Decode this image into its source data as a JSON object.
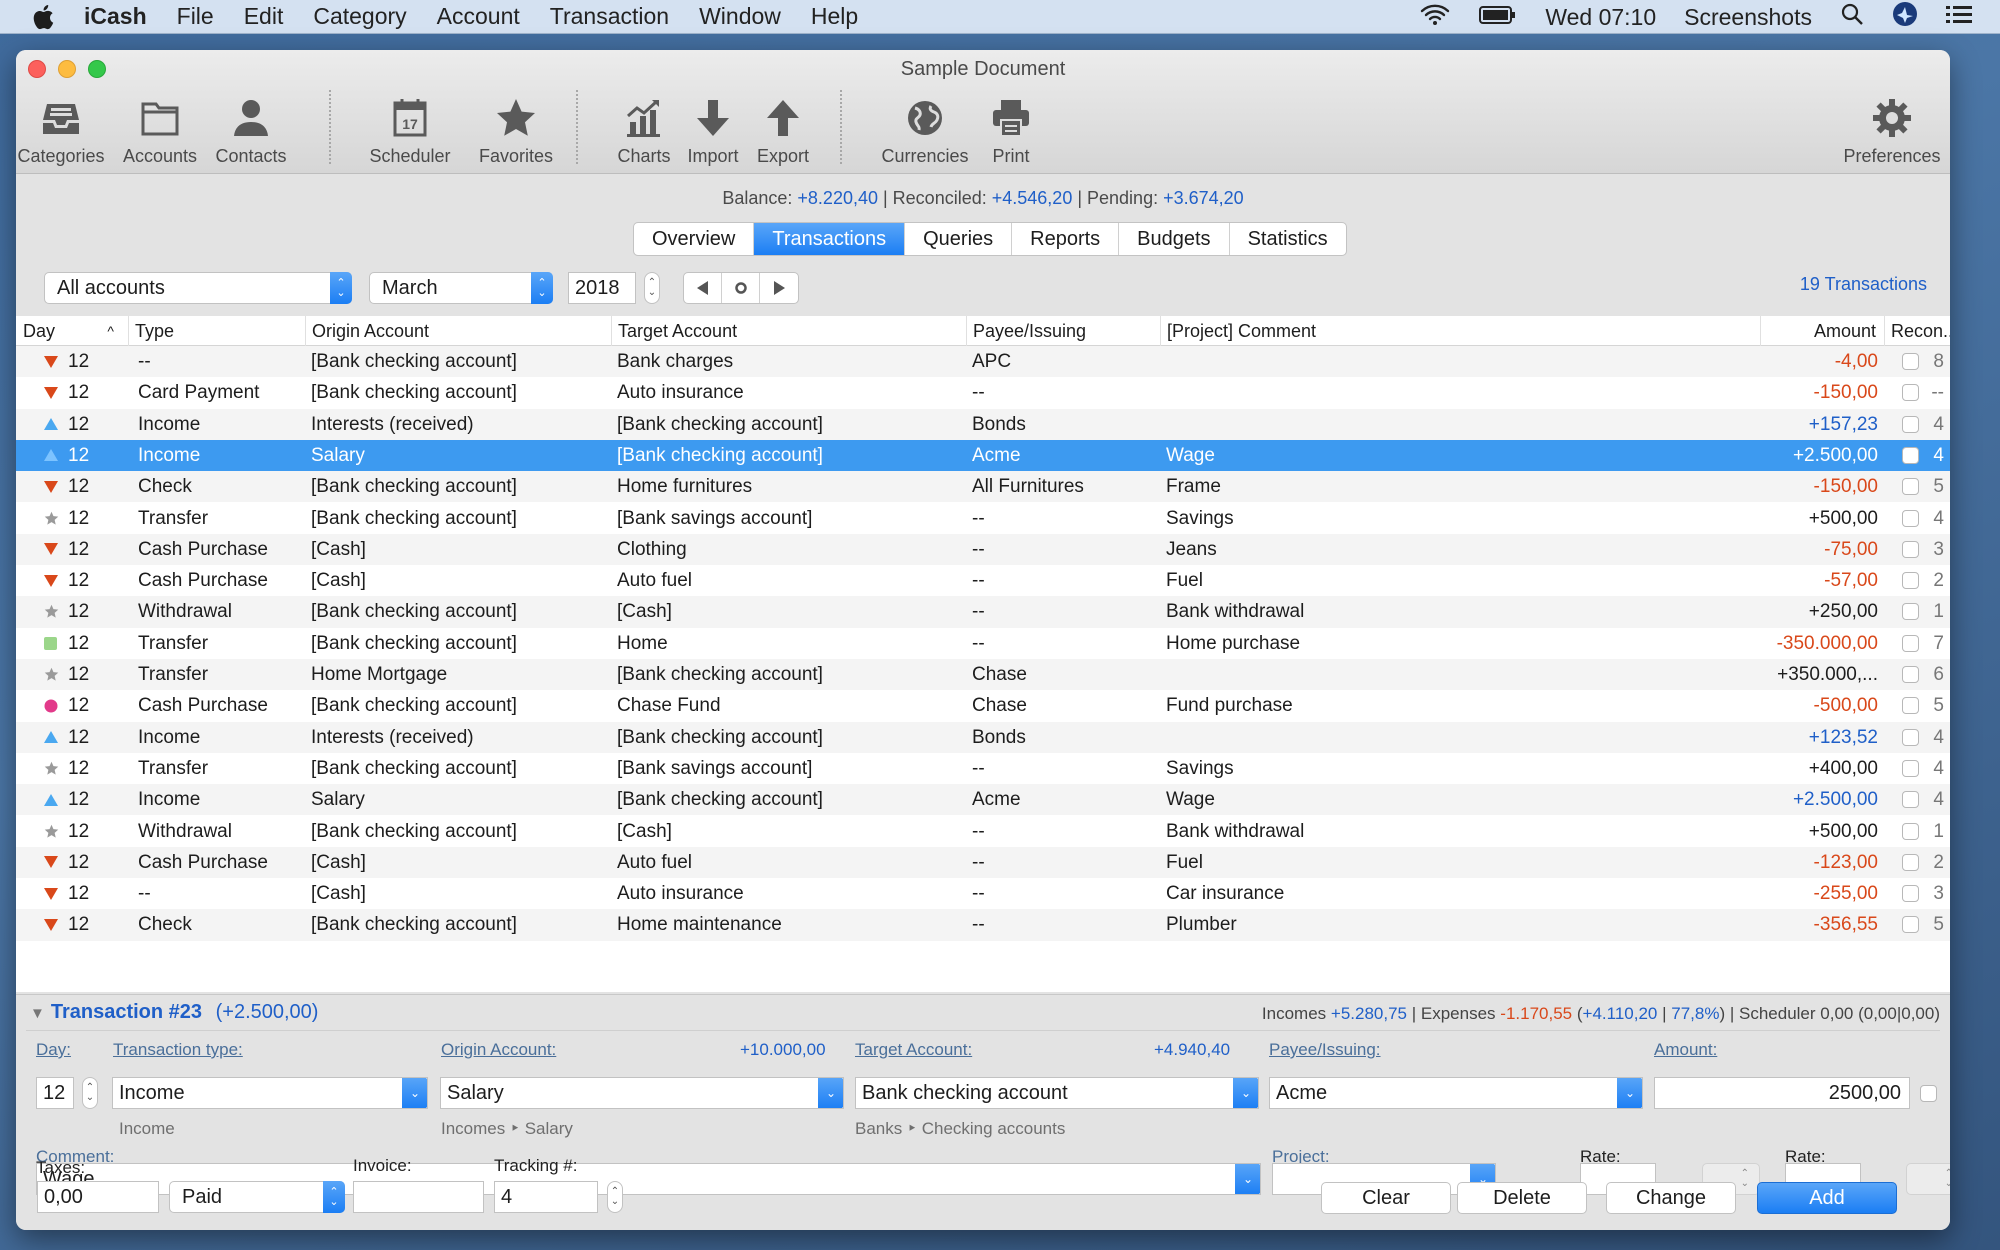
{
  "menubar": {
    "app_name": "iCash",
    "items": [
      "File",
      "Edit",
      "Category",
      "Account",
      "Transaction",
      "Window",
      "Help"
    ],
    "clock": "Wed 07:10",
    "user": "Screenshots"
  },
  "window": {
    "title": "Sample Document"
  },
  "toolbar": {
    "categories": "Categories",
    "accounts": "Accounts",
    "contacts": "Contacts",
    "scheduler": "Scheduler",
    "scheduler_day": "17",
    "favorites": "Favorites",
    "charts": "Charts",
    "import": "Import",
    "export": "Export",
    "currencies": "Currencies",
    "print": "Print",
    "preferences": "Preferences"
  },
  "balance": {
    "balance_label": "Balance:",
    "balance_value": "+8.220,40",
    "reconciled_label": "Reconciled:",
    "reconciled_value": "+4.546,20",
    "pending_label": "Pending:",
    "pending_value": "+3.674,20",
    "sep": " | "
  },
  "tabs": [
    {
      "label": "Overview",
      "active": false
    },
    {
      "label": "Transactions",
      "active": true
    },
    {
      "label": "Queries",
      "active": false
    },
    {
      "label": "Reports",
      "active": false
    },
    {
      "label": "Budgets",
      "active": false
    },
    {
      "label": "Statistics",
      "active": false
    }
  ],
  "filters": {
    "account": "All accounts",
    "month": "March",
    "year": "2018",
    "count": "19 Transactions"
  },
  "table": {
    "columns": [
      "Day",
      "Type",
      "Origin Account",
      "Target Account",
      "Payee/Issuing",
      "[Project] Comment",
      "Amount",
      "Recon..."
    ],
    "colors": {
      "expense": "#d9481a",
      "income": "#1f5fc8",
      "neutral": "#1d1d1d"
    },
    "rows": [
      {
        "icon": "down-triangle",
        "day": "12",
        "type": "--",
        "origin": "[Bank checking account]",
        "target": "Bank charges",
        "payee": "APC",
        "comment": "",
        "amount": "-4,00",
        "kind": "expense",
        "reconciled": false,
        "num": "8"
      },
      {
        "icon": "down-triangle",
        "day": "12",
        "type": "Card Payment",
        "origin": "[Bank checking account]",
        "target": "Auto insurance",
        "payee": "--",
        "comment": "",
        "amount": "-150,00",
        "kind": "expense",
        "reconciled": false,
        "num": "--"
      },
      {
        "icon": "up-triangle",
        "day": "12",
        "type": "Income",
        "origin": "Interests (received)",
        "target": "[Bank checking account]",
        "payee": "Bonds",
        "comment": "",
        "amount": "+157,23",
        "kind": "income",
        "reconciled": false,
        "num": "4"
      },
      {
        "icon": "up-triangle",
        "day": "12",
        "type": "Income",
        "origin": "Salary",
        "target": "[Bank checking account]",
        "payee": "Acme",
        "comment": "Wage",
        "amount": "+2.500,00",
        "kind": "income",
        "reconciled": false,
        "num": "4",
        "selected": true
      },
      {
        "icon": "down-triangle",
        "day": "12",
        "type": "Check",
        "origin": "[Bank checking account]",
        "target": "Home furnitures",
        "payee": "All Furnitures",
        "comment": "Frame",
        "amount": "-150,00",
        "kind": "expense",
        "reconciled": false,
        "num": "5"
      },
      {
        "icon": "star",
        "day": "12",
        "type": "Transfer",
        "origin": "[Bank checking account]",
        "target": "[Bank savings account]",
        "payee": "--",
        "comment": "Savings",
        "amount": "+500,00",
        "kind": "neutral",
        "reconciled": false,
        "num": "4"
      },
      {
        "icon": "down-triangle",
        "day": "12",
        "type": "Cash Purchase",
        "origin": "[Cash]",
        "target": "Clothing",
        "payee": "--",
        "comment": "Jeans",
        "amount": "-75,00",
        "kind": "expense",
        "reconciled": false,
        "num": "3"
      },
      {
        "icon": "down-triangle",
        "day": "12",
        "type": "Cash Purchase",
        "origin": "[Cash]",
        "target": "Auto fuel",
        "payee": "--",
        "comment": "Fuel",
        "amount": "-57,00",
        "kind": "expense",
        "reconciled": false,
        "num": "2"
      },
      {
        "icon": "star",
        "day": "12",
        "type": "Withdrawal",
        "origin": "[Bank checking account]",
        "target": "[Cash]",
        "payee": "--",
        "comment": "Bank withdrawal",
        "amount": "+250,00",
        "kind": "neutral",
        "reconciled": false,
        "num": "1"
      },
      {
        "icon": "square",
        "day": "12",
        "type": "Transfer",
        "origin": "[Bank checking account]",
        "target": "Home",
        "payee": "--",
        "comment": "Home purchase",
        "amount": "-350.000,00",
        "kind": "expense",
        "reconciled": false,
        "num": "7"
      },
      {
        "icon": "star",
        "day": "12",
        "type": "Transfer",
        "origin": "Home Mortgage",
        "target": "[Bank checking account]",
        "payee": "Chase",
        "comment": "",
        "amount": "+350.000,...",
        "kind": "neutral",
        "reconciled": false,
        "num": "6"
      },
      {
        "icon": "circle",
        "day": "12",
        "type": "Cash Purchase",
        "origin": "[Bank checking account]",
        "target": "Chase Fund",
        "payee": "Chase",
        "comment": "Fund purchase",
        "amount": "-500,00",
        "kind": "expense",
        "reconciled": false,
        "num": "5"
      },
      {
        "icon": "up-triangle",
        "day": "12",
        "type": "Income",
        "origin": "Interests (received)",
        "target": "[Bank checking account]",
        "payee": "Bonds",
        "comment": "",
        "amount": "+123,52",
        "kind": "income",
        "reconciled": false,
        "num": "4"
      },
      {
        "icon": "star",
        "day": "12",
        "type": "Transfer",
        "origin": "[Bank checking account]",
        "target": "[Bank savings account]",
        "payee": "--",
        "comment": "Savings",
        "amount": "+400,00",
        "kind": "neutral",
        "reconciled": false,
        "num": "4"
      },
      {
        "icon": "up-triangle",
        "day": "12",
        "type": "Income",
        "origin": "Salary",
        "target": "[Bank checking account]",
        "payee": "Acme",
        "comment": "Wage",
        "amount": "+2.500,00",
        "kind": "income",
        "reconciled": false,
        "num": "4"
      },
      {
        "icon": "star",
        "day": "12",
        "type": "Withdrawal",
        "origin": "[Bank checking account]",
        "target": "[Cash]",
        "payee": "--",
        "comment": "Bank withdrawal",
        "amount": "+500,00",
        "kind": "neutral",
        "reconciled": false,
        "num": "1"
      },
      {
        "icon": "down-triangle",
        "day": "12",
        "type": "Cash Purchase",
        "origin": "[Cash]",
        "target": "Auto fuel",
        "payee": "--",
        "comment": "Fuel",
        "amount": "-123,00",
        "kind": "expense",
        "reconciled": false,
        "num": "2"
      },
      {
        "icon": "down-triangle",
        "day": "12",
        "type": "--",
        "origin": "[Cash]",
        "target": "Auto insurance",
        "payee": "--",
        "comment": "Car insurance",
        "amount": "-255,00",
        "kind": "expense",
        "reconciled": false,
        "num": "3"
      },
      {
        "icon": "down-triangle",
        "day": "12",
        "type": "Check",
        "origin": "[Bank checking account]",
        "target": "Home maintenance",
        "payee": "--",
        "comment": "Plumber",
        "amount": "-356,55",
        "kind": "expense",
        "reconciled": false,
        "num": "5"
      }
    ]
  },
  "detail": {
    "title": "Transaction #23",
    "title_amount": "(+2.500,00)",
    "stats": {
      "incomes_label": "Incomes",
      "incomes_value": "+5.280,75",
      "expenses_label": "| Expenses",
      "expenses_value": "-1.170,55",
      "net_open": "(",
      "net_value": "+4.110,20",
      "pct_sep": " | ",
      "pct_value": "77,8%",
      "net_close": ")",
      "scheduler": "| Scheduler 0,00 (0,00|0,00)"
    },
    "day_label": "Day:",
    "day_value": "12",
    "type_label": "Transaction type:",
    "type_value": "Income",
    "type_sub": "Income",
    "origin_label": "Origin Account:",
    "origin_balance": "+10.000,00",
    "origin_value": "Salary",
    "origin_sub": "Incomes ‣ Salary",
    "target_label": "Target Account:",
    "target_balance": "+4.940,40",
    "target_value": "Bank checking account",
    "target_sub": "Banks ‣ Checking accounts",
    "payee_label": "Payee/Issuing:",
    "payee_value": "Acme",
    "amount_label": "Amount:",
    "amount_value": "2500,00",
    "comment_label": "Comment:",
    "comment_value": "Wage",
    "project_label": "Project:",
    "project_value": "",
    "rate1_label": "Rate:",
    "rate2_label": "Rate:",
    "taxes_label": "Taxes:",
    "taxes_value": "0,00",
    "tax_status": "Paid",
    "invoice_label": "Invoice:",
    "invoice_value": "",
    "tracking_label": "Tracking #:",
    "tracking_value": "4",
    "buttons": {
      "clear": "Clear",
      "delete": "Delete",
      "change": "Change",
      "add": "Add"
    }
  }
}
